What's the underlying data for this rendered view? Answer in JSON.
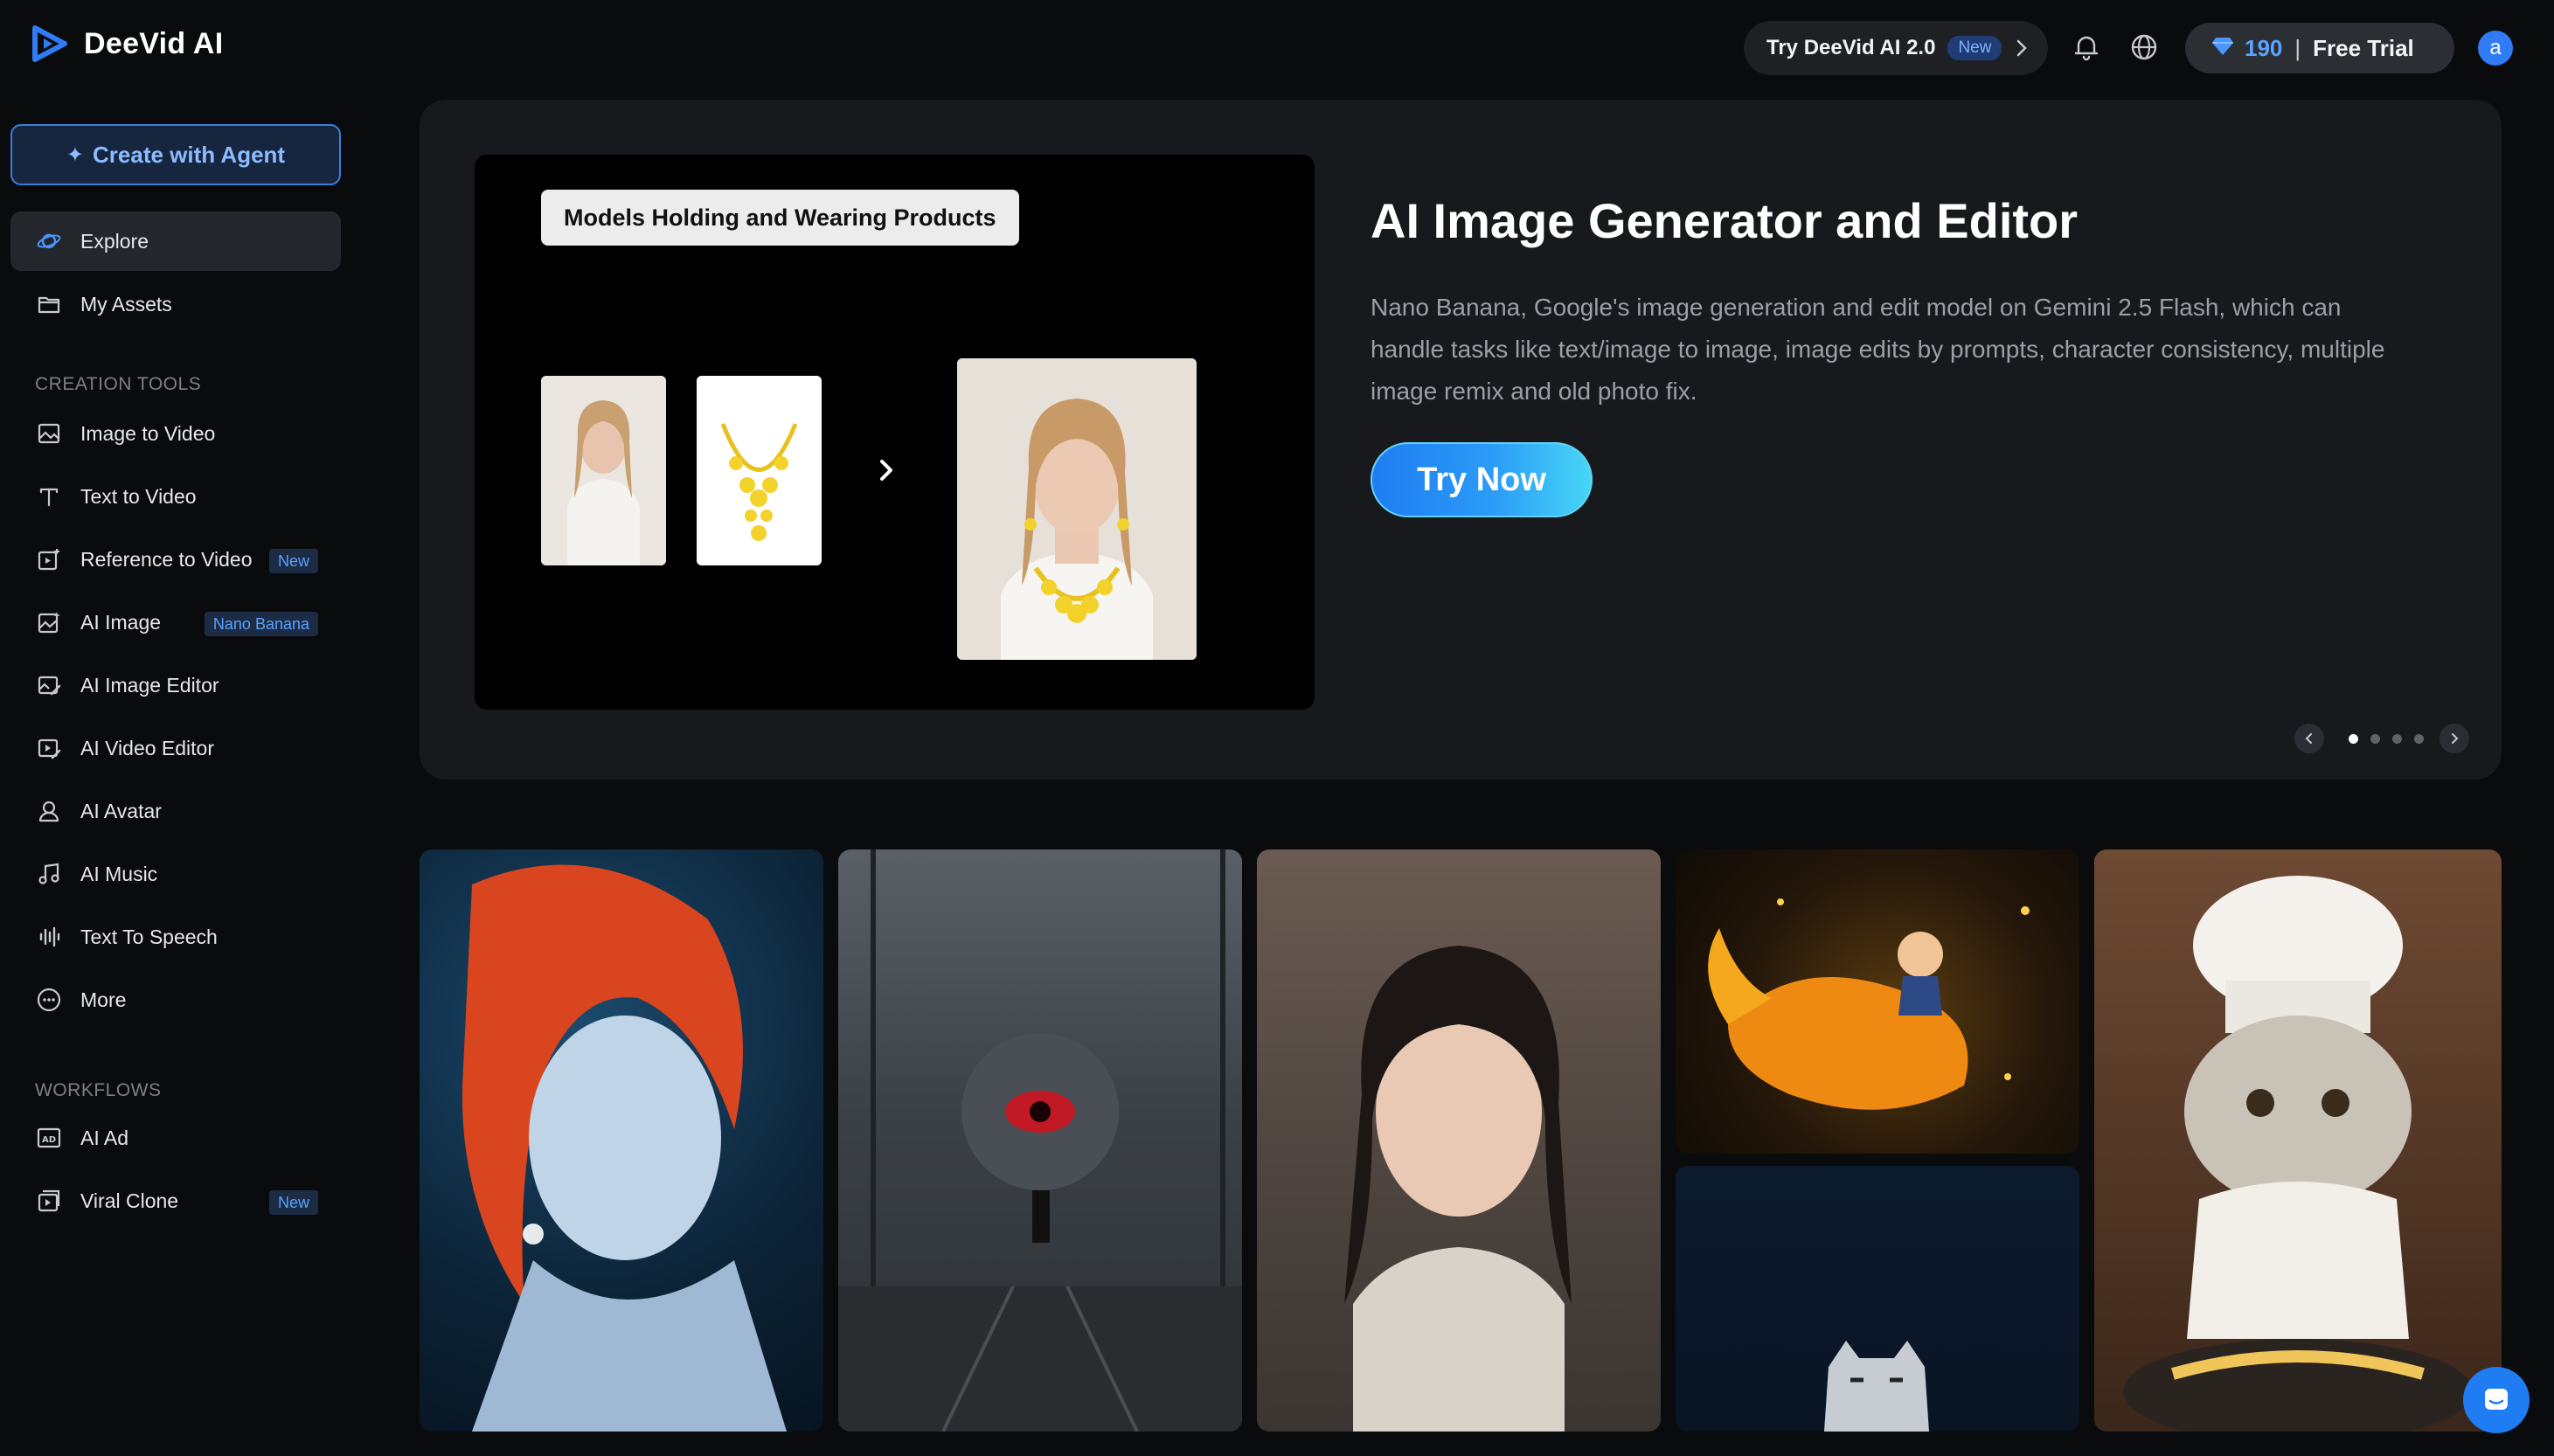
{
  "app": {
    "brand": "DeeVid AI"
  },
  "topbar": {
    "try_label": "Try DeeVid AI 2.0",
    "try_badge": "New",
    "credits": "190",
    "credits_sep": "|",
    "plan": "Free Trial",
    "avatar_initial": "a"
  },
  "sidebar": {
    "agent_button": "Create with Agent",
    "explore": "Explore",
    "my_assets": "My Assets",
    "creation_tools_title": "CREATION TOOLS",
    "tools": [
      {
        "label": "Image to Video",
        "icon": "image-icon"
      },
      {
        "label": "Text to Video",
        "icon": "text-icon"
      },
      {
        "label": "Reference to Video",
        "badge": "New",
        "icon": "reference-icon"
      },
      {
        "label": "AI Image",
        "badge": "Nano Banana",
        "icon": "ai-image-icon"
      },
      {
        "label": "AI Image Editor",
        "icon": "image-editor-icon"
      },
      {
        "label": "AI Video Editor",
        "icon": "video-editor-icon"
      },
      {
        "label": "AI Avatar",
        "icon": "avatar-icon"
      },
      {
        "label": "AI Music",
        "icon": "music-icon"
      },
      {
        "label": "Text To Speech",
        "icon": "speech-icon"
      },
      {
        "label": "More",
        "icon": "more-icon"
      }
    ],
    "workflows_title": "WORKFLOWS",
    "workflows": [
      {
        "label": "AI Ad",
        "icon": "ad-icon"
      },
      {
        "label": "Viral Clone",
        "badge": "New",
        "icon": "clone-icon"
      }
    ]
  },
  "hero": {
    "media_tag": "Models Holding and Wearing Products",
    "title": "AI Image Generator and Editor",
    "description": "Nano Banana, Google's image generation and edit model on Gemini 2.5 Flash, which can handle tasks like text/image to image, image edits by prompts, character consistency, multiple image remix and old photo fix.",
    "cta": "Try Now",
    "slides_total": 4,
    "active_slide": 1
  },
  "colors": {
    "accent": "#2f7cf6",
    "background": "#0a0b0d",
    "panel": "#17191d"
  }
}
